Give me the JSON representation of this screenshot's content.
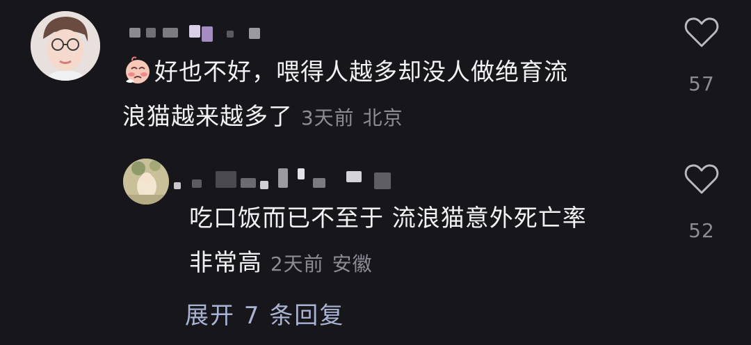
{
  "comment": {
    "avatar_icon": "user-avatar-woman-glasses",
    "text_line1": "好也不好，喂得人越多却没人做绝育流",
    "text_line2": "浪猫越来越多了",
    "time": "3天前",
    "location": "北京",
    "likes": "57",
    "emoji_icon": "sad-face-emoji"
  },
  "reply": {
    "avatar_icon": "user-avatar-photo",
    "text_line1": "吃口饭而已不至于 流浪猫意外死亡率",
    "text_line2": "非常高",
    "time": "2天前",
    "location": "安徽",
    "likes": "52"
  },
  "expand_label": "展开 7 条回复",
  "colors": {
    "background": "#16161b",
    "text": "#f2f2f5",
    "meta": "#8c8c94",
    "link": "#a9b4d4"
  }
}
